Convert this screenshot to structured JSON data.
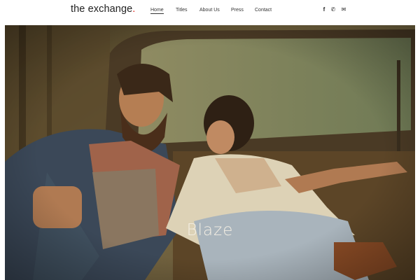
{
  "header": {
    "logo": "the exchange",
    "logo_dot": "."
  },
  "nav": {
    "items": [
      {
        "label": "Home",
        "active": true
      },
      {
        "label": "Titles",
        "active": false
      },
      {
        "label": "About Us",
        "active": false
      },
      {
        "label": "Press",
        "active": false
      },
      {
        "label": "Contact",
        "active": false
      }
    ],
    "social": [
      {
        "icon": "facebook-icon",
        "glyph": "f"
      },
      {
        "icon": "phone-icon",
        "glyph": "✆"
      },
      {
        "icon": "envelope-icon",
        "glyph": "✉"
      }
    ]
  },
  "hero": {
    "title": "Blaze"
  },
  "colors": {
    "accent": "#e2231a",
    "text": "#333333"
  }
}
